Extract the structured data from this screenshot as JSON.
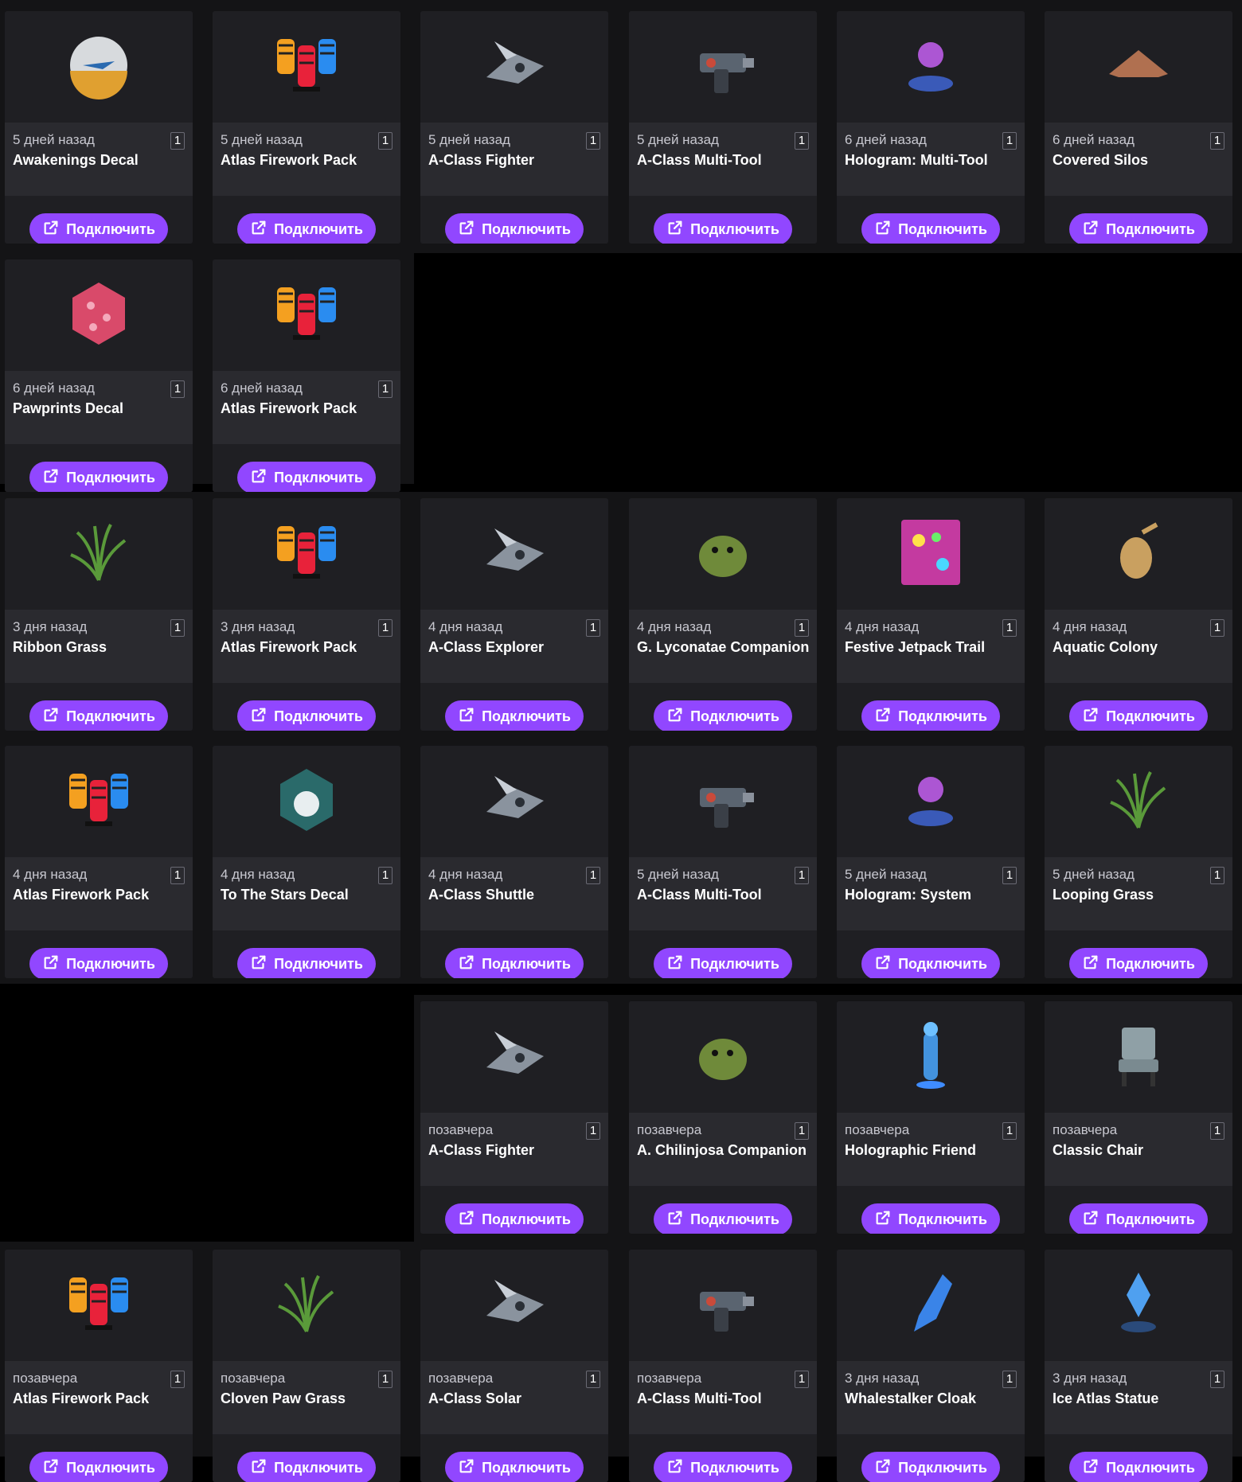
{
  "connect_label": "Подключить",
  "rows": [
    [
      {
        "when": "5 дней назад",
        "qty": "1",
        "name": "Awakenings Decal",
        "icon": "awakenings-decal-icon"
      },
      {
        "when": "5 дней назад",
        "qty": "1",
        "name": "Atlas Firework Pack",
        "icon": "firework-pack-icon"
      },
      {
        "when": "5 дней назад",
        "qty": "1",
        "name": "A-Class Fighter",
        "icon": "fighter-ship-icon"
      },
      {
        "when": "5 дней назад",
        "qty": "1",
        "name": "A-Class Multi-Tool",
        "icon": "multi-tool-icon"
      },
      {
        "when": "6 дней назад",
        "qty": "1",
        "name": "Hologram: Multi-Tool",
        "icon": "hologram-multitool-icon"
      },
      {
        "when": "6 дней назад",
        "qty": "1",
        "name": "Covered Silos",
        "icon": "covered-silos-icon"
      }
    ],
    [
      {
        "when": "6 дней назад",
        "qty": "1",
        "name": "Pawprints Decal",
        "icon": "pawprints-decal-icon"
      },
      {
        "when": "6 дней назад",
        "qty": "1",
        "name": "Atlas Firework Pack",
        "icon": "firework-pack-icon"
      }
    ],
    [
      {
        "when": "3 дня назад",
        "qty": "1",
        "name": "Ribbon Grass",
        "icon": "grass-icon"
      },
      {
        "when": "3 дня назад",
        "qty": "1",
        "name": "Atlas Firework Pack",
        "icon": "firework-pack-icon"
      },
      {
        "when": "4 дня назад",
        "qty": "1",
        "name": "A-Class Explorer",
        "icon": "explorer-ship-icon"
      },
      {
        "when": "4 дня назад",
        "qty": "1",
        "name": "G. Lyconatae Companion",
        "icon": "companion-creature-icon"
      },
      {
        "when": "4 дня назад",
        "qty": "1",
        "name": "Festive Jetpack Trail",
        "icon": "jetpack-trail-icon"
      },
      {
        "when": "4 дня назад",
        "qty": "1",
        "name": "Aquatic Colony",
        "icon": "aquatic-colony-icon"
      }
    ],
    [
      {
        "when": "4 дня назад",
        "qty": "1",
        "name": "Atlas Firework Pack",
        "icon": "firework-pack-icon"
      },
      {
        "when": "4 дня назад",
        "qty": "1",
        "name": "To The Stars Decal",
        "icon": "stars-decal-icon"
      },
      {
        "when": "4 дня назад",
        "qty": "1",
        "name": "A-Class Shuttle",
        "icon": "shuttle-ship-icon"
      },
      {
        "when": "5 дней назад",
        "qty": "1",
        "name": "A-Class Multi-Tool",
        "icon": "multi-tool-icon"
      },
      {
        "when": "5 дней назад",
        "qty": "1",
        "name": "Hologram: System",
        "icon": "hologram-system-icon"
      },
      {
        "when": "5 дней назад",
        "qty": "1",
        "name": "Looping Grass",
        "icon": "grass-icon"
      }
    ],
    [
      {
        "when": "позавчера",
        "qty": "1",
        "name": "A-Class Fighter",
        "icon": "fighter-ship-icon"
      },
      {
        "when": "позавчера",
        "qty": "1",
        "name": "A. Chilinjosa Companion",
        "icon": "companion-creature-icon"
      },
      {
        "when": "позавчера",
        "qty": "1",
        "name": "Holographic Friend",
        "icon": "holographic-friend-icon"
      },
      {
        "when": "позавчера",
        "qty": "1",
        "name": "Classic Chair",
        "icon": "chair-icon"
      }
    ],
    [
      {
        "when": "позавчера",
        "qty": "1",
        "name": "Atlas Firework Pack",
        "icon": "firework-pack-icon"
      },
      {
        "when": "позавчера",
        "qty": "1",
        "name": "Cloven Paw Grass",
        "icon": "grass-icon"
      },
      {
        "when": "позавчера",
        "qty": "1",
        "name": "A-Class Solar",
        "icon": "solar-ship-icon"
      },
      {
        "when": "позавчера",
        "qty": "1",
        "name": "A-Class Multi-Tool",
        "icon": "multi-tool-icon"
      },
      {
        "when": "3 дня назад",
        "qty": "1",
        "name": "Whalestalker Cloak",
        "icon": "cloak-icon"
      },
      {
        "when": "3 дня назад",
        "qty": "1",
        "name": "Ice Atlas Statue",
        "icon": "statue-icon"
      }
    ]
  ]
}
